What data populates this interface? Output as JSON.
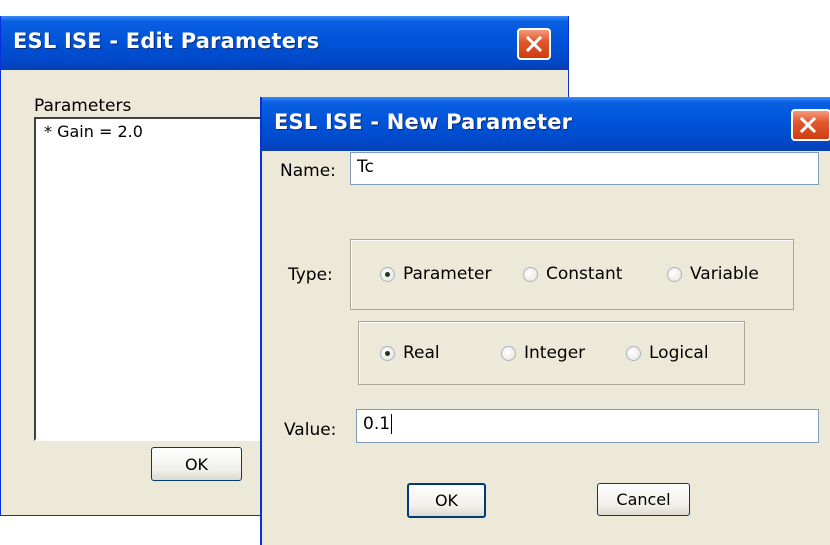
{
  "edit_dialog": {
    "title": "ESL ISE - Edit Parameters",
    "parameters_label": "Parameters",
    "parameters_list": [
      "* Gain = 2.0"
    ],
    "ok_label": "OK"
  },
  "new_dialog": {
    "title": "ESL ISE - New Parameter",
    "name_label": "Name:",
    "name_value": "Tc",
    "type_label": "Type:",
    "type_options": [
      "Parameter",
      "Constant",
      "Variable"
    ],
    "type_selected": "Parameter",
    "kind_options": [
      "Real",
      "Integer",
      "Logical"
    ],
    "kind_selected": "Real",
    "value_label": "Value:",
    "value_value": "0.1",
    "ok_label": "OK",
    "cancel_label": "Cancel"
  },
  "colors": {
    "titlebar": "#0052d6",
    "dialog_face": "#ece9d8",
    "close_button": "#e2582d"
  }
}
